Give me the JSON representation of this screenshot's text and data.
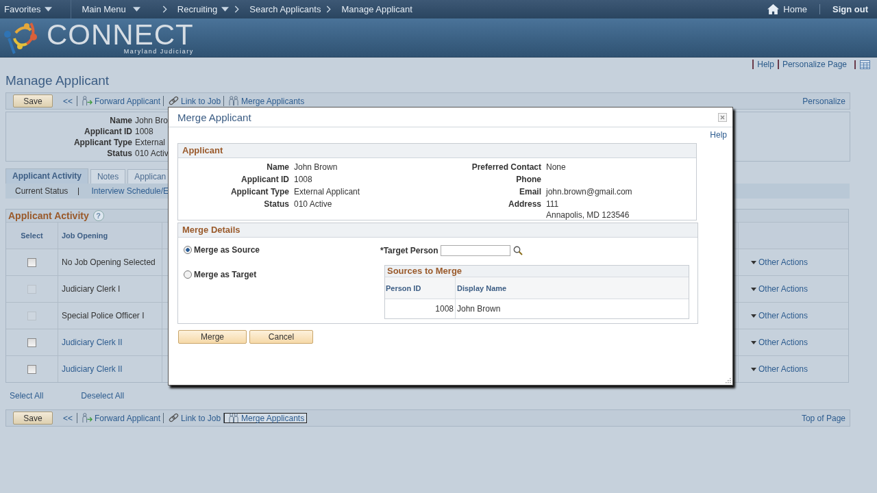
{
  "nav": {
    "favorites": "Favorites",
    "main_menu": "Main Menu",
    "breadcrumbs": [
      {
        "label": "Recruiting",
        "menu": true
      },
      {
        "label": "Search Applicants",
        "menu": false
      },
      {
        "label": "Manage Applicant",
        "menu": false
      }
    ],
    "home": "Home",
    "sign_out": "Sign out"
  },
  "logo": {
    "title": "CONNECT",
    "subtitle": "Maryland Judiciary"
  },
  "page_links": [
    "Help",
    "Personalize Page"
  ],
  "page_title": "Manage Applicant",
  "toolbar_top": {
    "save": "Save",
    "back": "<<",
    "actions": [
      {
        "label": "Forward Applicant",
        "kind": "forward",
        "focused": false
      },
      {
        "label": "Link to Job",
        "kind": "link",
        "focused": false
      },
      {
        "label": "Merge Applicants",
        "kind": "merge",
        "focused": false
      }
    ],
    "right": "Personalize"
  },
  "summary": [
    {
      "label": "Name",
      "value": "John Bro"
    },
    {
      "label": "Applicant ID",
      "value": "1008"
    },
    {
      "label": "Applicant Type",
      "value": "External"
    },
    {
      "label": "Status",
      "value": "010 Activ"
    }
  ],
  "tabs": [
    {
      "label": "Applicant Activity",
      "selected": true
    },
    {
      "label": "Notes",
      "selected": false
    },
    {
      "label": "Applican",
      "selected": false
    }
  ],
  "subtabs": [
    {
      "label": "Current Status",
      "link": false
    },
    {
      "label": "Interview Schedule/E",
      "link": true
    }
  ],
  "activity": {
    "title": "Applicant Activity",
    "help": "?",
    "columns": [
      "Select",
      "Job Opening"
    ],
    "rows": [
      {
        "checked": false,
        "disabled": false,
        "job": "No Job Opening Selected",
        "link": false,
        "action": "Other Actions"
      },
      {
        "checked": false,
        "disabled": true,
        "job": "Judiciary Clerk I",
        "link": false,
        "action": "Other Actions"
      },
      {
        "checked": false,
        "disabled": true,
        "job": "Special Police Officer I",
        "link": false,
        "action": "Other Actions"
      },
      {
        "checked": false,
        "disabled": false,
        "job": "Judiciary Clerk II",
        "link": true,
        "action": "Other Actions"
      },
      {
        "checked": false,
        "disabled": false,
        "job": "Judiciary Clerk II",
        "link": true,
        "action": "Other Actions"
      }
    ]
  },
  "select_all": "Select All",
  "deselect_all": "Deselect All",
  "toolbar_bottom": {
    "save": "Save",
    "back": "<<",
    "actions": [
      {
        "label": "Forward Applicant",
        "kind": "forward",
        "focused": false
      },
      {
        "label": "Link to Job",
        "kind": "link",
        "focused": false
      },
      {
        "label": "Merge Applicants",
        "kind": "merge",
        "focused": true
      }
    ],
    "right": "Top of Page"
  },
  "modal": {
    "title": "Merge Applicant",
    "help": "Help",
    "applicant": {
      "title": "Applicant",
      "left": [
        {
          "label": "Name",
          "value": [
            "John Brown"
          ]
        },
        {
          "label": "Applicant ID",
          "value": [
            "1008"
          ]
        },
        {
          "label": "Applicant Type",
          "value": [
            "External Applicant"
          ]
        },
        {
          "label": "Status",
          "value": [
            "010 Active"
          ]
        }
      ],
      "right": [
        {
          "label": "Preferred Contact",
          "value": [
            "None"
          ]
        },
        {
          "label": "Phone"
        },
        {
          "label": "Email",
          "value": [
            "john.brown@gmail.com"
          ]
        },
        {
          "label": "Address",
          "value": [
            "111",
            "Annapolis, MD 123546"
          ]
        }
      ]
    },
    "merge_details": {
      "title": "Merge Details",
      "options": [
        {
          "label": "Merge as Source",
          "selected": true
        },
        {
          "label": "Merge as Target",
          "selected": false
        }
      ],
      "target_label": "*Target Person",
      "sources": {
        "title": "Sources to Merge",
        "columns": [
          "Person ID",
          "Display Name"
        ],
        "rows": [
          {
            "person_id": "1008",
            "display_name": "John Brown"
          }
        ]
      }
    },
    "buttons": [
      "Merge",
      "Cancel"
    ]
  }
}
